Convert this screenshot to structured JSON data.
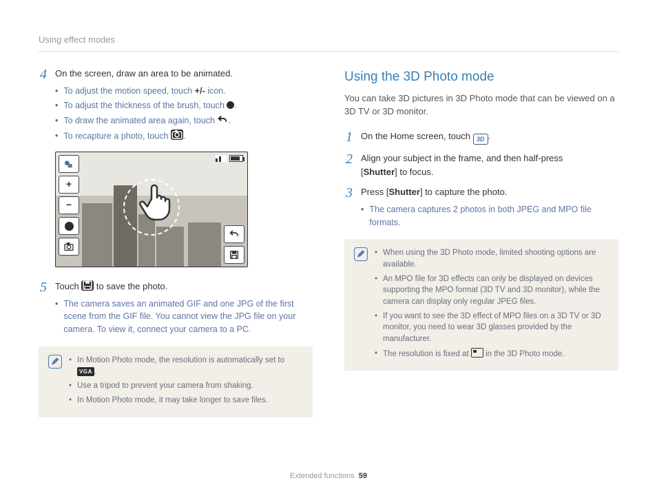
{
  "header": {
    "breadcrumb": "Using effect modes"
  },
  "left": {
    "step4": {
      "num": "4",
      "text": "On the screen, draw an area to be animated.",
      "bullets": [
        "To adjust the motion speed, touch +/- icon.",
        "To adjust the thickness of the brush, touch ●.",
        "To draw the animated area again, touch ↶.",
        "To recapture a photo, touch 📷."
      ]
    },
    "screen": {
      "btn_mode": "mode",
      "btn_plus": "+",
      "btn_minus": "−",
      "btn_brush": "●",
      "btn_camera": "cam",
      "btn_undo": "↶",
      "btn_save": "save"
    },
    "step5": {
      "num": "5",
      "text_before": "Touch ",
      "text_after": " to save the photo.",
      "bullets": [
        "The camera saves an animated GIF and one JPG of the first scene from the GIF file. You cannot view the JPG file on your camera. To view it, connect your camera to a PC."
      ]
    },
    "note": {
      "items": [
        {
          "before": "In Motion Photo mode, the resolution is automatically set to ",
          "badge": "VGA",
          "after": "."
        },
        {
          "before": "Use a tripod to prevent your camera from shaking.",
          "badge": "",
          "after": ""
        },
        {
          "before": "In Motion Photo mode, it may take longer to save files.",
          "badge": "",
          "after": ""
        }
      ]
    }
  },
  "right": {
    "title": "Using the 3D Photo mode",
    "intro": "You can take 3D pictures in 3D Photo mode that can be viewed on a 3D TV or 3D monitor.",
    "step1": {
      "num": "1",
      "before": "On the Home screen, touch ",
      "after": "."
    },
    "step2": {
      "num": "2",
      "line1_before": "Align your subject in the frame, and then half-press",
      "line2_before": "[",
      "line2_bold": "Shutter",
      "line2_after": "] to focus."
    },
    "step3": {
      "num": "3",
      "before": "Press [",
      "bold": "Shutter",
      "after": "] to capture the photo.",
      "bullets": [
        "The camera captures 2 photos in both JPEG and MPO file formats."
      ]
    },
    "note": {
      "items": [
        "When using the 3D Photo mode, limited shooting options are available.",
        "An MPO file for 3D effects can only be displayed on devices supporting the MPO format (3D TV and 3D monitor), while the camera can display only regular JPEG files.",
        "If you want to see the 3D effect of MPO files on a 3D TV or 3D monitor, you need to wear 3D glasses provided by the manufacturer.",
        "__RES__The resolution is fixed at __ICON__ in the 3D Photo mode."
      ]
    }
  },
  "footer": {
    "section": "Extended functions",
    "page": "59"
  }
}
